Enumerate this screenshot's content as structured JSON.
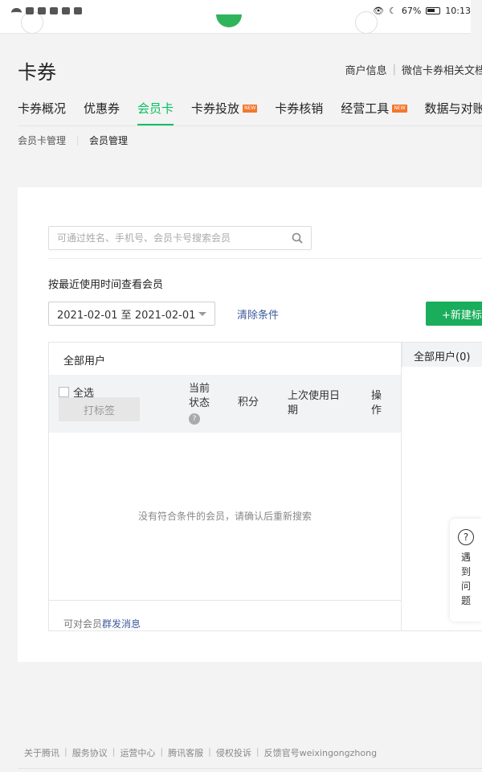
{
  "status_bar": {
    "battery": "67%",
    "time": "10:13"
  },
  "page": {
    "title": "卡券"
  },
  "top_links": [
    "商户信息",
    "微信卡券相关文档"
  ],
  "main_tabs": [
    {
      "label": "卡券概况"
    },
    {
      "label": "优惠券"
    },
    {
      "label": "会员卡",
      "active": true
    },
    {
      "label": "卡券投放",
      "badge": "NEW"
    },
    {
      "label": "卡券核销"
    },
    {
      "label": "经营工具",
      "badge": "NEW"
    },
    {
      "label": "数据与对账"
    }
  ],
  "sub_tabs": [
    {
      "label": "会员卡管理"
    },
    {
      "label": "会员管理",
      "active": true
    }
  ],
  "search": {
    "placeholder": "可通过姓名、手机号、会员卡号搜索会员",
    "value": ""
  },
  "filter": {
    "label": "按最近使用时间查看会员",
    "date_range": "2021-02-01 至 2021-02-01",
    "clear_label": "清除条件",
    "new_tag_label": "+新建标签"
  },
  "member_table": {
    "title": "全部用户",
    "select_all": "全选",
    "tag_button": "打标签",
    "columns": [
      "当前状态",
      "积分",
      "上次使用日期",
      "操作"
    ],
    "empty_message": "没有符合条件的会员，请确认后重新搜索",
    "footer_prefix": "可对会员",
    "footer_link": "群发消息"
  },
  "tag_panel": {
    "header": "全部用户(0)"
  },
  "help_widget": {
    "label": "遇到问题"
  },
  "footer_links": [
    "关于腾讯",
    "服务协议",
    "运营中心",
    "腾讯客服",
    "侵权投诉",
    "反馈官号weixingongzhong"
  ],
  "colors": {
    "accent": "#07c160",
    "link": "#3d5a9c",
    "badge": "#f3772d"
  }
}
